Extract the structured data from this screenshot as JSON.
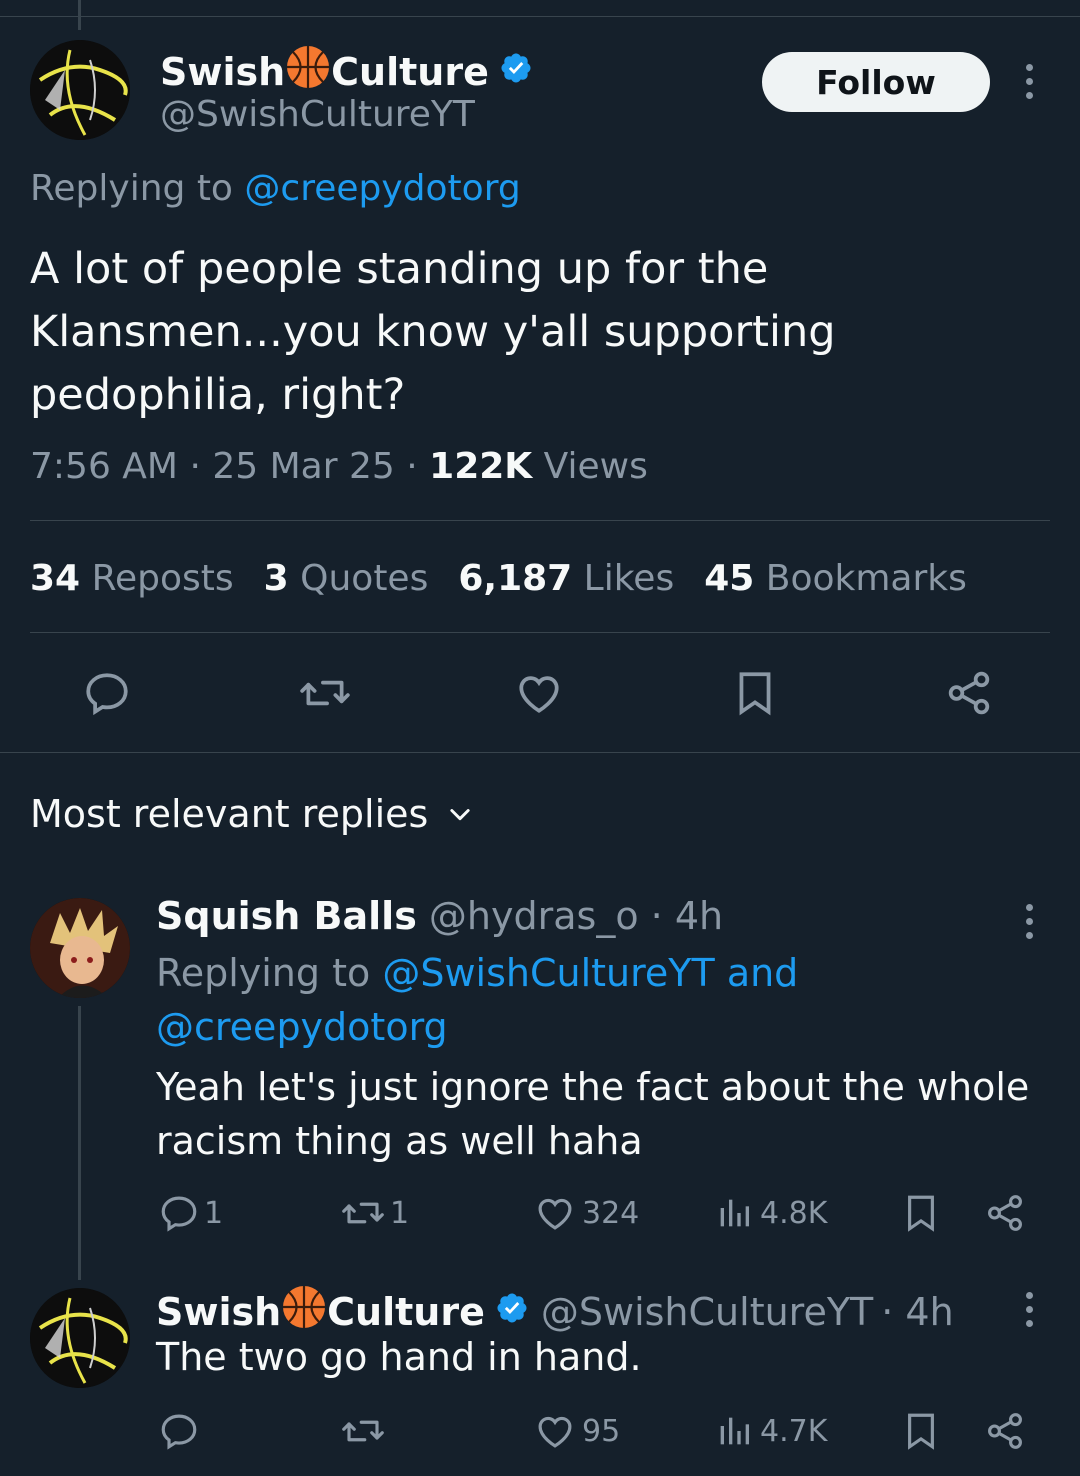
{
  "main_tweet": {
    "display_name_parts": [
      "Swish",
      "Culture"
    ],
    "handle": "@SwishCultureYT",
    "follow_label": "Follow",
    "replying_prefix": "Replying to",
    "replying_to": "@creepydotorg",
    "text_lines": [
      "A lot of people standing up for the",
      "Klansmen...you know y'all supporting",
      "pedophilia, right?"
    ],
    "time": "7:56 AM",
    "sep": "·",
    "date": "25 Mar 25",
    "views_count": "122K",
    "views_label": "Views",
    "stats": [
      {
        "count": "34",
        "label": "Reposts"
      },
      {
        "count": "3",
        "label": "Quotes"
      },
      {
        "count": "6,187",
        "label": "Likes"
      },
      {
        "count": "45",
        "label": "Bookmarks"
      }
    ]
  },
  "sort_label": "Most relevant replies",
  "replies": [
    {
      "display_name": "Squish Balls",
      "handle": "@hydras_o",
      "age": "· 4h",
      "replying_prefix": "Replying to",
      "replying_to_1": "@SwishCultureYT",
      "replying_and": "and",
      "replying_to_2": "@creepydotorg",
      "text_lines": [
        "Yeah let's just ignore the fact about the whole",
        "racism thing as well haha"
      ],
      "replies": "1",
      "reposts": "1",
      "likes": "324",
      "views": "4.8K"
    },
    {
      "display_name_parts": [
        "Swish",
        "Culture"
      ],
      "handle": "@SwishCultureYT",
      "age": "· 4h",
      "text": "The two go hand in hand.",
      "replies": "",
      "reposts": "",
      "likes": "95",
      "views": "4.7K"
    }
  ],
  "colors": {
    "background": "#15202b",
    "text": "#f7f9f9",
    "muted": "#8b98a5",
    "link": "#1d9bf0",
    "divider": "#38444d",
    "follow_bg": "#eff3f4"
  }
}
